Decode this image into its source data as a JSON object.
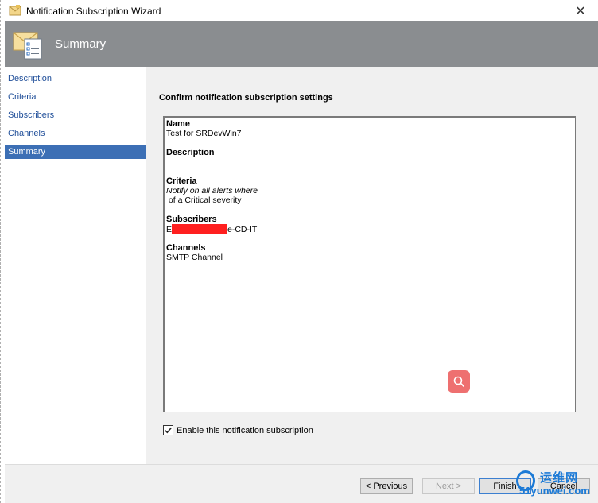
{
  "window": {
    "title": "Notification Subscription Wizard",
    "close_label": "✕"
  },
  "header": {
    "title": "Summary"
  },
  "nav": {
    "items": [
      {
        "label": "Description"
      },
      {
        "label": "Criteria"
      },
      {
        "label": "Subscribers"
      },
      {
        "label": "Channels"
      },
      {
        "label": "Summary",
        "active": true
      }
    ]
  },
  "main": {
    "heading": "Confirm notification subscription settings",
    "summary": {
      "name_label": "Name",
      "name_value": "Test for SRDevWin7",
      "description_label": "Description",
      "description_value": "",
      "criteria_label": "Criteria",
      "criteria_line1": "Notify on all alerts where",
      "criteria_line2": " of a Critical severity",
      "subscribers_label": "Subscribers",
      "subscribers_prefix": "E",
      "subscribers_suffix": "e-CD-IT",
      "channels_label": "Channels",
      "channels_value": "SMTP Channel"
    },
    "enable_checkbox": {
      "label": "Enable this notification subscription",
      "checked": true
    }
  },
  "footer": {
    "previous_label": "< Previous",
    "next_label": "Next >",
    "finish_label": "Finish",
    "cancel_label": "Cancel"
  },
  "watermark": {
    "cn_text": "运维网",
    "en_text": "51yunwei.com"
  },
  "colors": {
    "header_bg": "#8a8d90",
    "nav_active": "#3c6fb5",
    "nav_text": "#1f4e99",
    "redaction": "#ff1f1f",
    "search_fab": "#ee7070"
  }
}
